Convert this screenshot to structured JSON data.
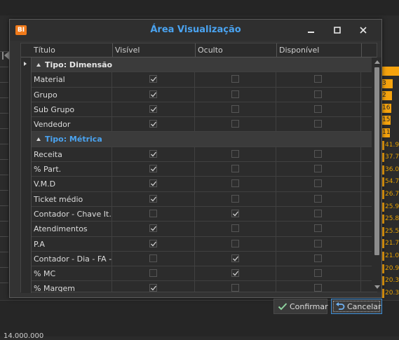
{
  "dialog": {
    "title": "Área Visualização",
    "app_icon_text": "BI",
    "columns": [
      "Título",
      "Visível",
      "Oculto",
      "Disponível"
    ],
    "rows": [
      {
        "type": "group",
        "label": "Tipo: Dimensão",
        "style": "dim"
      },
      {
        "type": "item",
        "label": "Material",
        "visible": true,
        "hidden": false,
        "available": false
      },
      {
        "type": "item",
        "label": "Grupo",
        "visible": true,
        "hidden": false,
        "available": false
      },
      {
        "type": "item",
        "label": "Sub Grupo",
        "visible": true,
        "hidden": false,
        "available": false
      },
      {
        "type": "item",
        "label": "Vendedor",
        "visible": true,
        "hidden": false,
        "available": false
      },
      {
        "type": "group",
        "label": "Tipo: Métrica",
        "style": "met"
      },
      {
        "type": "item",
        "label": "Receita",
        "visible": true,
        "hidden": false,
        "available": false
      },
      {
        "type": "item",
        "label": "% Part.",
        "visible": true,
        "hidden": false,
        "available": false
      },
      {
        "type": "item",
        "label": "V.M.D",
        "visible": true,
        "hidden": false,
        "available": false
      },
      {
        "type": "item",
        "label": "Ticket médio",
        "visible": true,
        "hidden": false,
        "available": false
      },
      {
        "type": "item",
        "label": "Contador - Chave It...",
        "visible": false,
        "hidden": true,
        "available": false
      },
      {
        "type": "item",
        "label": "Atendimentos",
        "visible": true,
        "hidden": false,
        "available": false
      },
      {
        "type": "item",
        "label": "P.A",
        "visible": true,
        "hidden": false,
        "available": false
      },
      {
        "type": "item",
        "label": "Contador - Dia - FA -...",
        "visible": false,
        "hidden": true,
        "available": false
      },
      {
        "type": "item",
        "label": "% MC",
        "visible": false,
        "hidden": true,
        "available": false
      },
      {
        "type": "item",
        "label": "% Margem",
        "visible": true,
        "hidden": false,
        "available": false
      }
    ],
    "confirm_label": "Confirmar",
    "cancel_label": "Cancelar"
  },
  "background": {
    "bottom_label": "14.000.000",
    "chart_labels": [
      "",
      "3",
      "2",
      "16",
      "15",
      "11",
      "41.9",
      "37.7",
      "36.0",
      "54.7",
      "26.7",
      "25.9",
      "25.8",
      "25.5",
      "21.7",
      "21.0",
      "20.9",
      "20.3",
      "20.3"
    ]
  },
  "colors": {
    "accent": "#4aa3f0",
    "bar": "#f5a30e",
    "app_icon": "#f07a1a"
  }
}
